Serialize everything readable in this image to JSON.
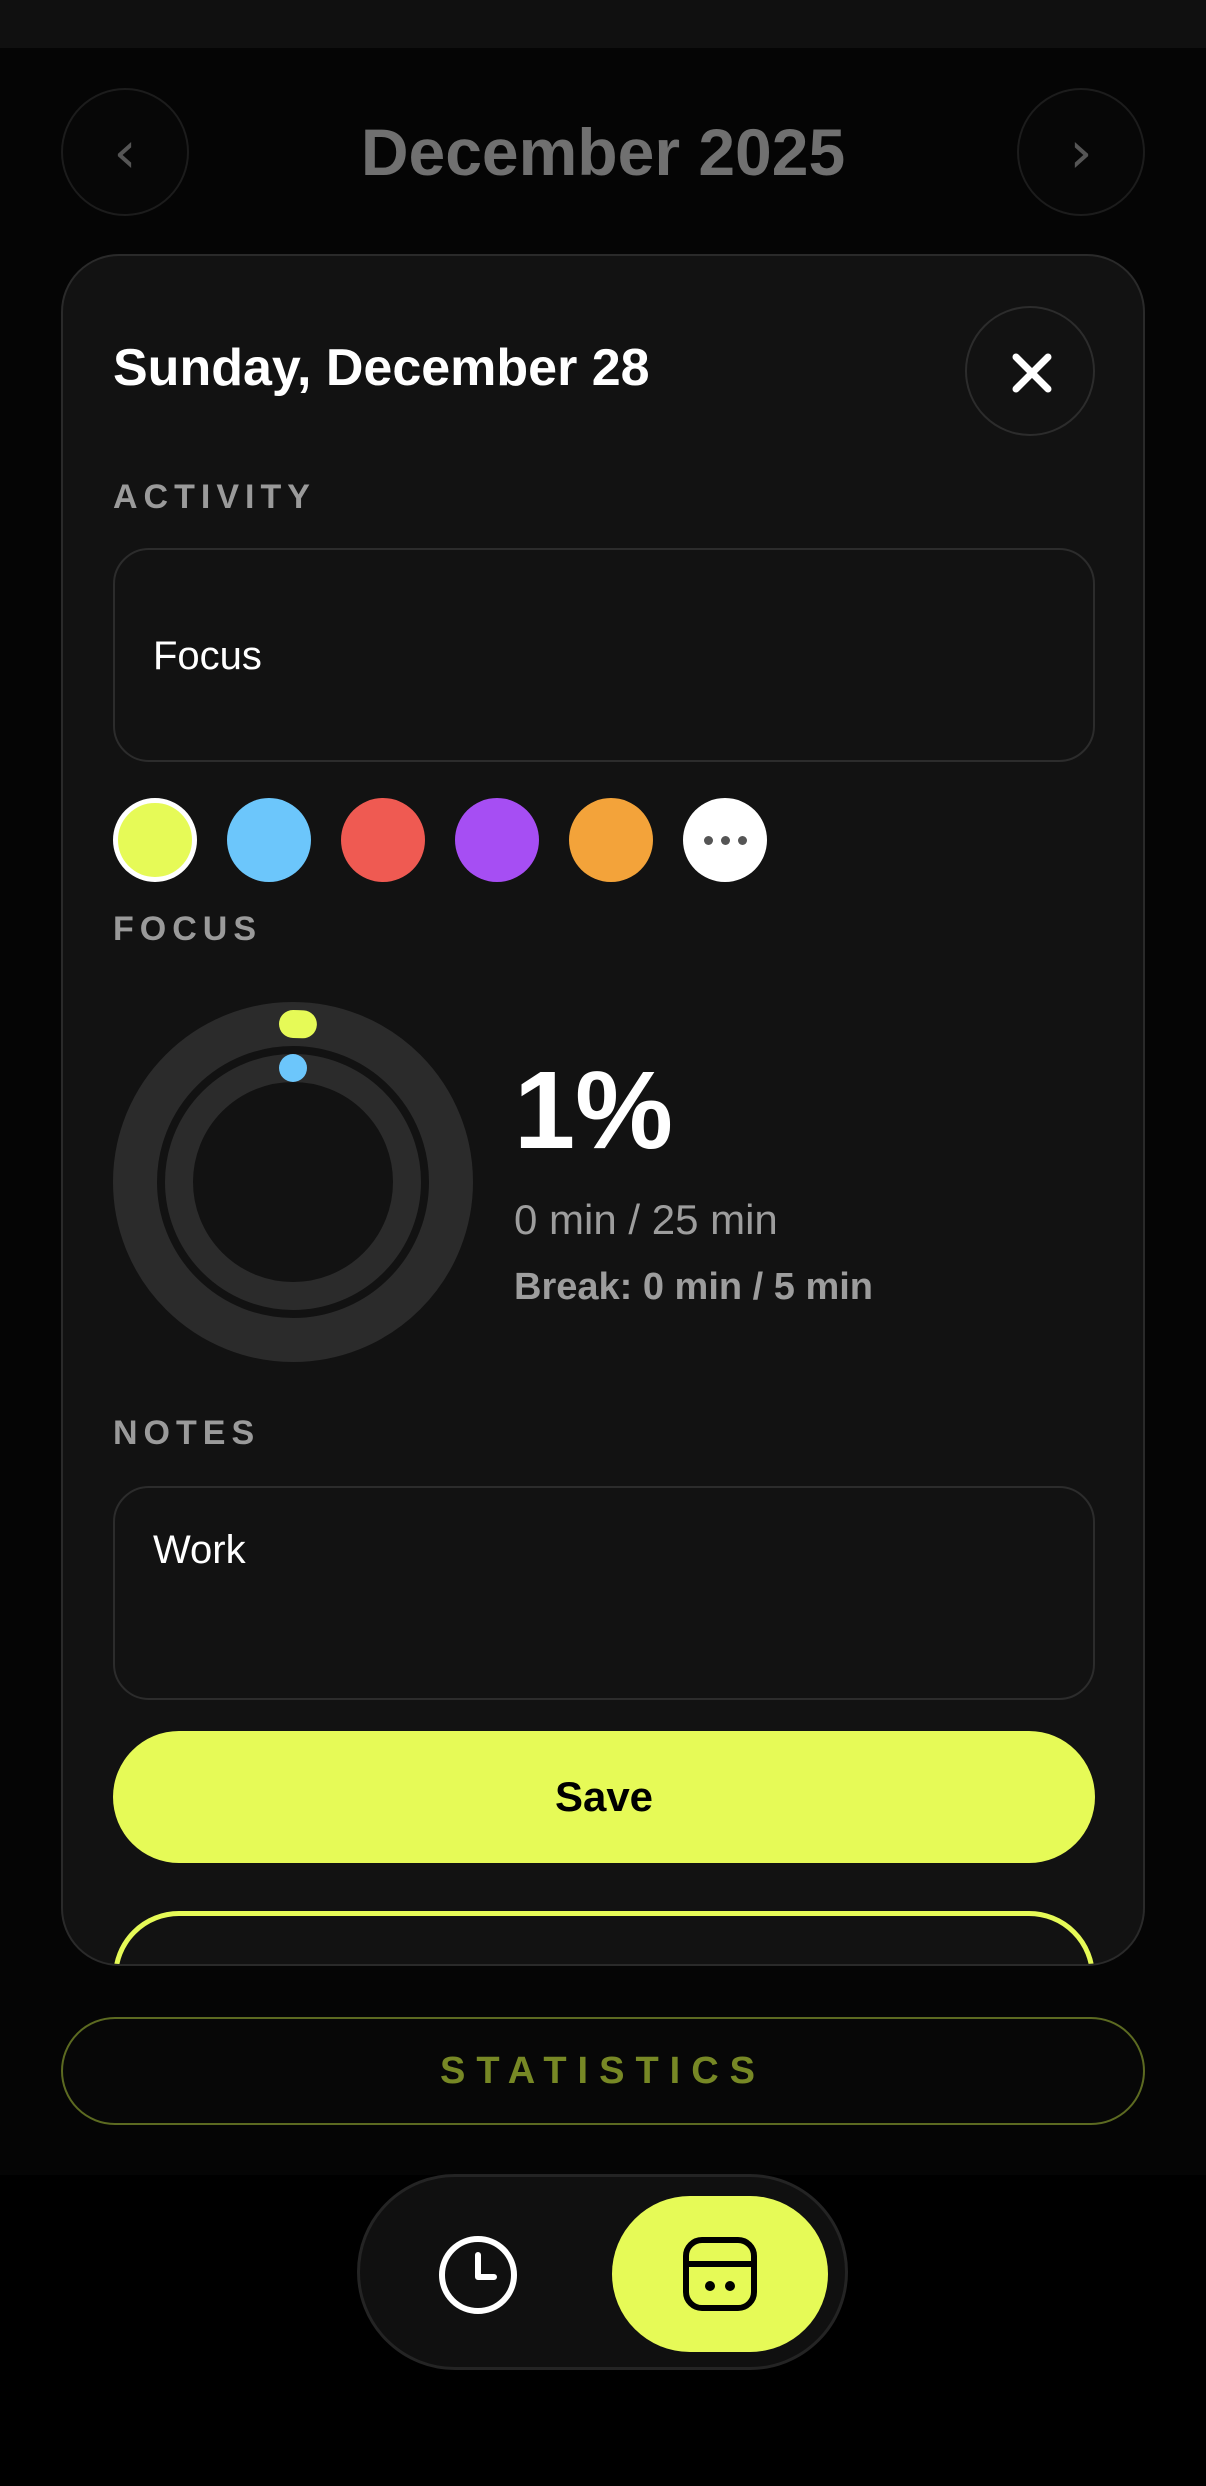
{
  "header": {
    "month_title": "December 2025",
    "prev_label": "‹",
    "next_label": "›"
  },
  "modal": {
    "date_title": "Sunday, December 28",
    "close_icon": "close-icon",
    "activity": {
      "label": "ACTIVITY",
      "value": "Focus"
    },
    "colors": [
      {
        "name": "lime",
        "hex": "#e6fa57",
        "selected": true
      },
      {
        "name": "blue",
        "hex": "#6cc6fb"
      },
      {
        "name": "red",
        "hex": "#ef5a52"
      },
      {
        "name": "purple",
        "hex": "#a64ef3"
      },
      {
        "name": "orange",
        "hex": "#f3a33a"
      },
      {
        "name": "more",
        "hex": "#ffffff",
        "icon": "more-dots-icon"
      }
    ],
    "focus": {
      "label": "FOCUS",
      "percent": "1%",
      "focus_progress": 0.01,
      "break_progress": 0.0,
      "time_text": "0 min / 25 min",
      "break_text": "Break: 0 min / 5 min"
    },
    "notes": {
      "label": "NOTES",
      "value": "Work"
    },
    "save_label": "Save"
  },
  "statistics_label": "STATISTICS",
  "dock": {
    "items": [
      {
        "name": "timer",
        "icon": "clock-icon",
        "active": false
      },
      {
        "name": "calendar",
        "icon": "calendar-icon",
        "active": true
      }
    ]
  },
  "colors": {
    "accent": "#e6fa57",
    "background": "#000000",
    "card": "#121212"
  }
}
